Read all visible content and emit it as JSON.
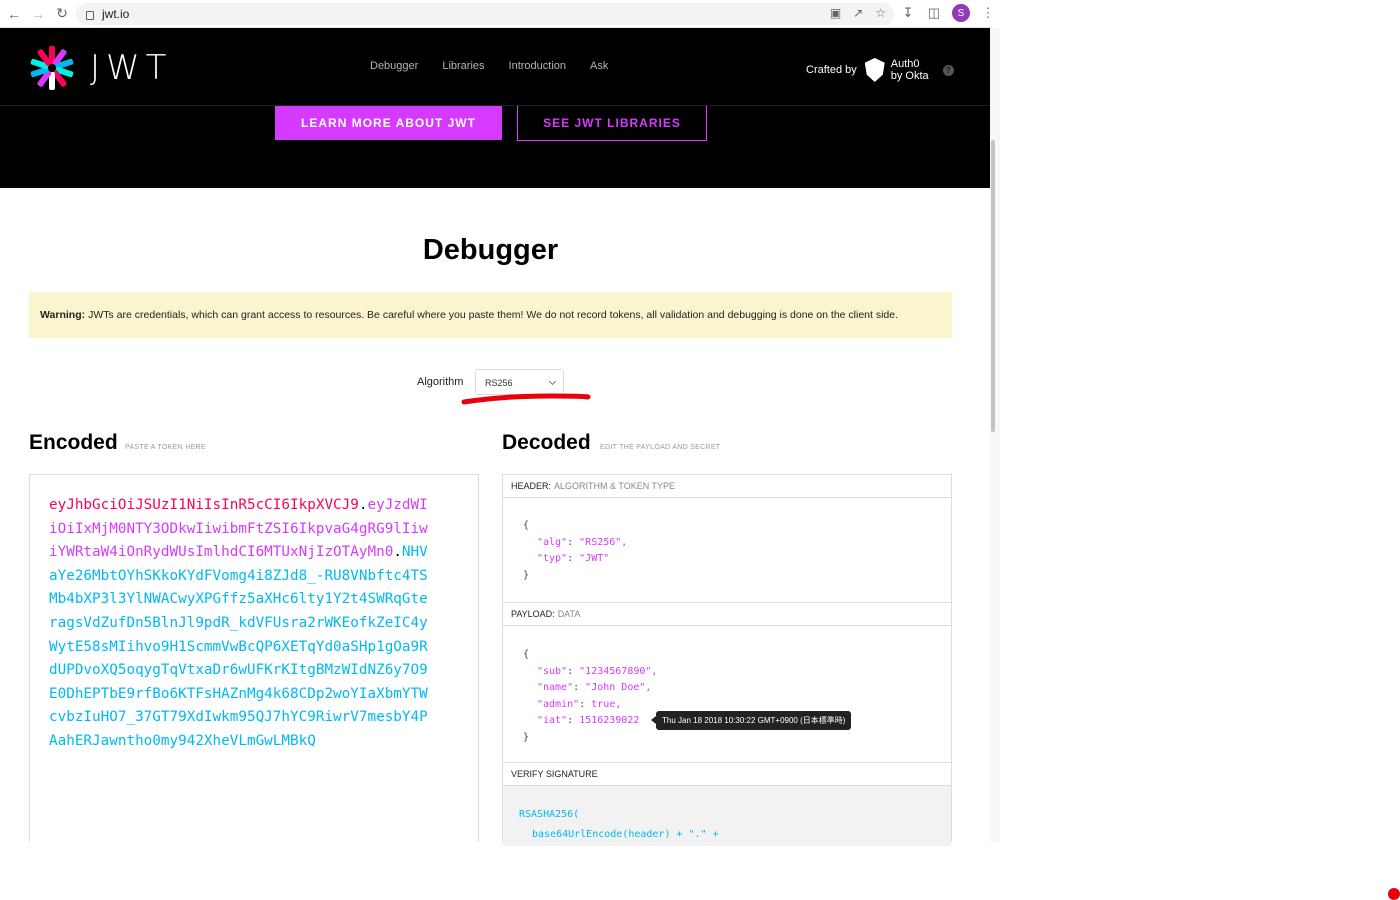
{
  "browser": {
    "url": "jwt.io",
    "profile_initial": "S"
  },
  "header": {
    "logo_text": "JWT",
    "nav": [
      "Debugger",
      "Libraries",
      "Introduction",
      "Ask"
    ],
    "crafted_label": "Crafted by",
    "brand_line1": "Auth0",
    "brand_line2": "by Okta"
  },
  "hero": {
    "learn_button": "LEARN MORE ABOUT JWT",
    "libs_button": "SEE JWT LIBRARIES"
  },
  "debugger": {
    "title": "Debugger",
    "warning_bold": "Warning:",
    "warning_text": "JWTs are credentials, which can grant access to resources. Be careful where you paste them! We do not record tokens, all validation and debugging is done on the client side.",
    "algorithm_label": "Algorithm",
    "algorithm_value": "RS256"
  },
  "encoded": {
    "title": "Encoded",
    "subtitle": "PASTE A TOKEN HERE",
    "header_part": "eyJhbGciOiJSUzI1NiIsInR5cCI6IkpXVCJ9",
    "payload_part": "eyJzdWIiOiIxMjM0NTY3ODkwIiwibmFtZSI6IkpvaG4gRG9lIiwiYWRtaW4iOnRydWUsImlhdCI6MTUxNjIzOTAyMn0",
    "signature_part": "NHVaYe26MbtOYhSKkoKYdFVomg4i8ZJd8_-RU8VNbftc4TSMb4bXP3l3YlNWACwyXPGffz5aXHc6lty1Y2t4SWRqGteragsVdZufDn5BlnJl9pdR_kdVFUsra2rWKEofkZeIC4yWytE58sMIihvo9H1ScmmVwBcQP6XETqYd0aSHp1gOa9RdUPDvoXQ5oqygTqVtxaDr6wUFKrKItgBMzWIdNZ6y7O9E0DhEPTbE9rfBo6KTFsHAZnMg4k68CDp2woYIaXbmYTWcvbzIuHO7_37GT79XdIwkm95QJ7hYC9RiwrV7mesbY4PAahERJawntho0my942XheVLmGwLMBkQ",
    "dot": "."
  },
  "decoded": {
    "title": "Decoded",
    "subtitle": "EDIT THE PAYLOAD AND SECRET",
    "header_label": "HEADER:",
    "header_sub": "ALGORITHM & TOKEN TYPE",
    "header_json": {
      "open": "{",
      "close": "}",
      "alg_key": "\"alg\"",
      "alg_val": "\"RS256\",",
      "typ_key": "\"typ\"",
      "typ_val": "\"JWT\""
    },
    "payload_label": "PAYLOAD:",
    "payload_sub": "DATA",
    "payload_json": {
      "open": "{",
      "close": "}",
      "sub_key": "\"sub\"",
      "sub_val": "\"1234567890\",",
      "name_key": "\"name\"",
      "name_val": "\"John Doe\",",
      "admin_key": "\"admin\"",
      "admin_val": "true,",
      "iat_key": "\"iat\"",
      "iat_val": "1516239022"
    },
    "iat_tooltip": "Thu Jan 18 2018 10:30:22 GMT+0900 (日本標準時)",
    "verify_label": "VERIFY SIGNATURE",
    "verify_line1": "RSASHA256(",
    "verify_line2": "base64UrlEncode(header) + \".\" +"
  },
  "colors": {
    "accent": "#d63aff",
    "token_header": "#fb015b",
    "token_signature": "#00b9f1",
    "warning_bg": "#fbf5cf",
    "annotation_red": "#e8000b"
  }
}
